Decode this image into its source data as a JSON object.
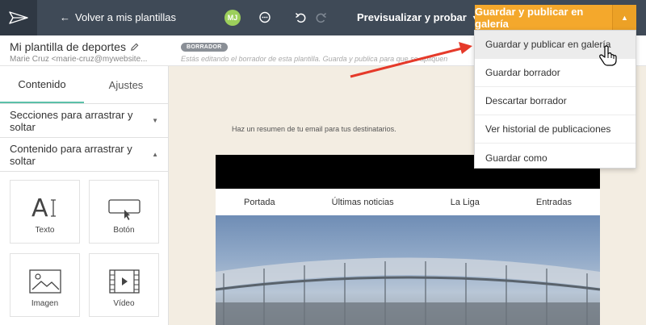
{
  "topbar": {
    "back_label": "Volver a mis plantillas",
    "avatar_initials": "MJ",
    "preview_label": "Previsualizar y probar",
    "publish_label": "Guardar y publicar en galería"
  },
  "subheader": {
    "template_name": "Mi plantilla de deportes",
    "sender": "Marie Cruz <marie-cruz@mywebsite...",
    "draft_badge": "BORRADOR",
    "draft_note": "Estás editando el borrador de esta plantilla. Guarda y publica para que se apliquen"
  },
  "sidebar": {
    "tabs": [
      {
        "label": "Contenido",
        "active": true
      },
      {
        "label": "Ajustes",
        "active": false
      }
    ],
    "sections": [
      {
        "label": "Secciones para arrastrar y soltar",
        "expanded": false
      },
      {
        "label": "Contenido para arrastrar y soltar",
        "expanded": true
      }
    ],
    "blocks": [
      {
        "label": "Texto",
        "icon": "text-icon"
      },
      {
        "label": "Botón",
        "icon": "button-icon"
      },
      {
        "label": "Imagen",
        "icon": "image-icon"
      },
      {
        "label": "Vídeo",
        "icon": "video-icon"
      }
    ]
  },
  "email": {
    "summary": "Haz un resumen de tu email para tus destinatarios.",
    "nav": [
      "Portada",
      "Últimas noticias",
      "La Liga",
      "Entradas"
    ]
  },
  "dropdown": {
    "items": [
      "Guardar y publicar en galería",
      "Guardar borrador",
      "Descartar borrador",
      "Ver historial de publicaciones",
      "Guardar como"
    ]
  },
  "colors": {
    "topbar": "#3f4a57",
    "accent": "#f4a82c",
    "tab_underline": "#5bc0a8",
    "arrow": "#e53a2a"
  }
}
